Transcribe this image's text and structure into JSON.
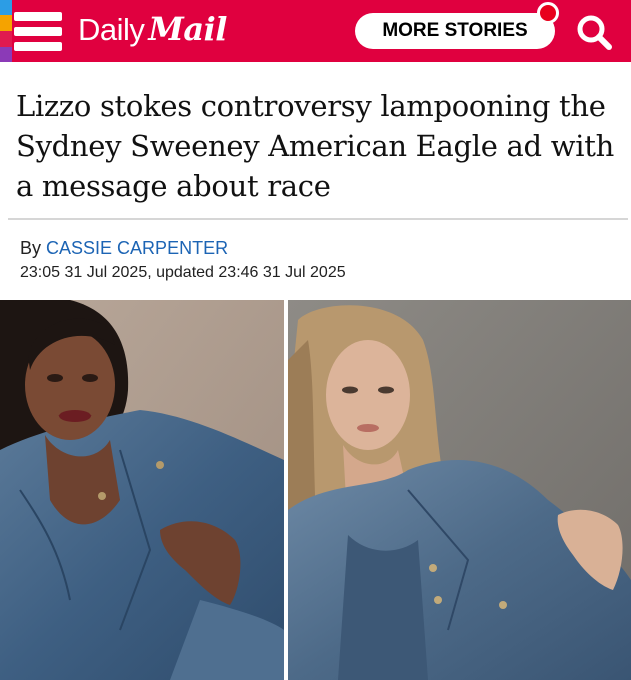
{
  "header": {
    "logo_daily": "Daily",
    "logo_mail": "Mail",
    "more_stories_label": "MORE STORIES",
    "menu_stripe_colors": [
      "#2c9de5",
      "#f5a300",
      "#e01a4f",
      "#8b3ab7"
    ],
    "brand_color": "#e0003f"
  },
  "article": {
    "headline": "Lizzo stokes controversy lampooning the Sydney Sweeney American Eagle ad with a message about race",
    "byline_prefix": "By",
    "author": "CASSIE CARPENTER",
    "dateline": "23:05 31 Jul 2025, updated 23:46 31 Jul 2025"
  },
  "images": [
    {
      "subject": "Lizzo in a denim jacket posing reclined",
      "icon": "photo-left"
    },
    {
      "subject": "Sydney Sweeney in a denim jacket posing reclined",
      "icon": "photo-right"
    }
  ]
}
